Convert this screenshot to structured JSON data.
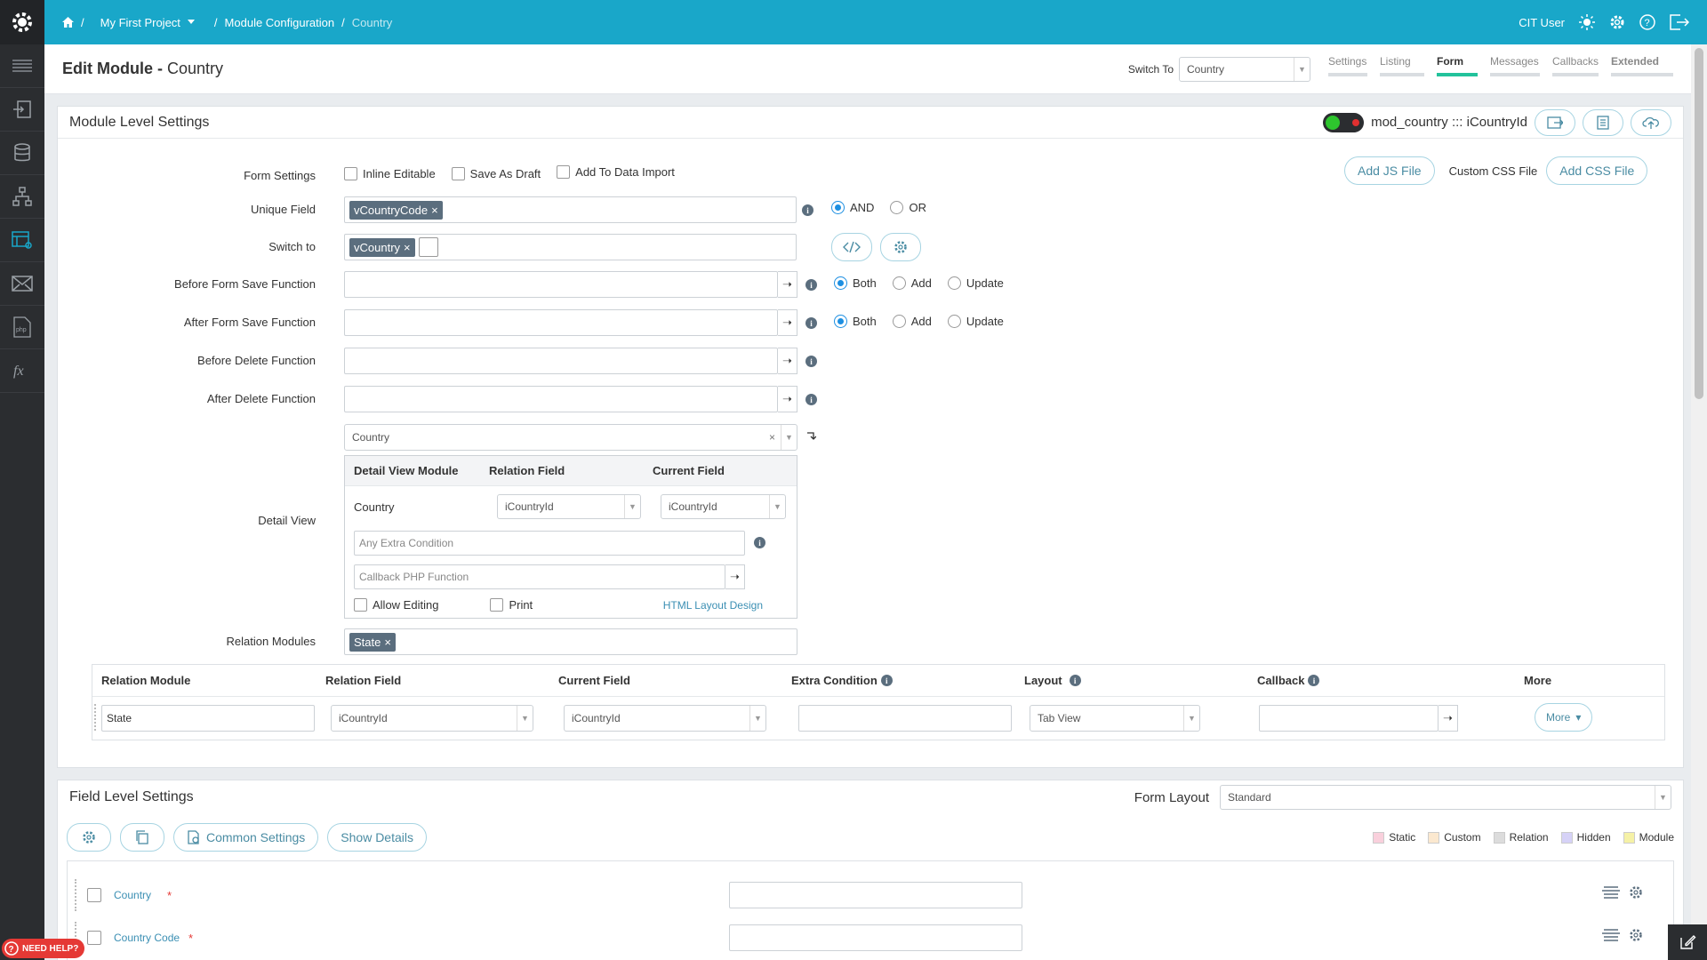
{
  "breadcrumb": {
    "sep": "/",
    "project": "My First Project",
    "module_config": "Module Configuration",
    "current": "Country"
  },
  "user": {
    "name": "CIT User"
  },
  "page": {
    "title_prefix": "Edit Module -",
    "title_module": "Country"
  },
  "switch_to": {
    "label": "Switch To",
    "value": "Country"
  },
  "tabs": [
    "Settings",
    "Listing",
    "Form",
    "Messages",
    "Callbacks",
    "Extended"
  ],
  "active_tab": "Form",
  "module_settings": {
    "title": "Module Level Settings",
    "table_key": "mod_country ::: iCountryId",
    "form_settings_label": "Form Settings",
    "inline_editable": "Inline Editable",
    "save_as_draft": "Save As Draft",
    "add_to_data_import": "Add To Data Import",
    "add_js": "Add JS File",
    "custom_css_label": "Custom CSS File",
    "add_css": "Add CSS File",
    "unique_field_label": "Unique Field",
    "unique_field_tag": "vCountryCode",
    "and": "AND",
    "or": "OR",
    "switch_to_label": "Switch to",
    "switch_to_tag": "vCountry",
    "before_form_save": "Before Form Save Function",
    "after_form_save": "After Form Save Function",
    "before_delete": "Before Delete Function",
    "after_delete": "After Delete Function",
    "both": "Both",
    "add": "Add",
    "update": "Update",
    "detail_view_label": "Detail View",
    "detail_view_select": "Country",
    "dv_col_module": "Detail View Module",
    "dv_col_relation": "Relation Field",
    "dv_col_current": "Current Field",
    "dv_module": "Country",
    "dv_relation_value": "iCountryId",
    "dv_current_value": "iCountryId",
    "extra_condition_placeholder": "Any Extra Condition",
    "callback_placeholder": "Callback PHP Function",
    "allow_editing": "Allow Editing",
    "print": "Print",
    "html_layout": "HTML Layout Design",
    "relation_modules_label": "Relation Modules",
    "relation_modules_tag": "State"
  },
  "relation_table": {
    "headers": [
      "Relation Module",
      "Relation Field",
      "Current Field",
      "Extra Condition",
      "Layout",
      "Callback",
      "More"
    ],
    "row": {
      "module": "State",
      "relation_field": "iCountryId",
      "current_field": "iCountryId",
      "layout": "Tab View",
      "more": "More"
    }
  },
  "field_settings": {
    "title": "Field Level Settings",
    "form_layout_label": "Form Layout",
    "form_layout_value": "Standard",
    "common_settings": "Common Settings",
    "show_details": "Show Details",
    "legend": [
      {
        "label": "Static",
        "color": "#f9d0dc"
      },
      {
        "label": "Custom",
        "color": "#fbe8cf"
      },
      {
        "label": "Relation",
        "color": "#dcdcdc"
      },
      {
        "label": "Hidden",
        "color": "#d6d2f7"
      },
      {
        "label": "Module",
        "color": "#f5f1a6"
      }
    ],
    "fields": [
      {
        "label": "Country",
        "required": "*"
      },
      {
        "label": "Country Code",
        "required": "*"
      }
    ]
  },
  "help": {
    "label": "NEED HELP?"
  }
}
